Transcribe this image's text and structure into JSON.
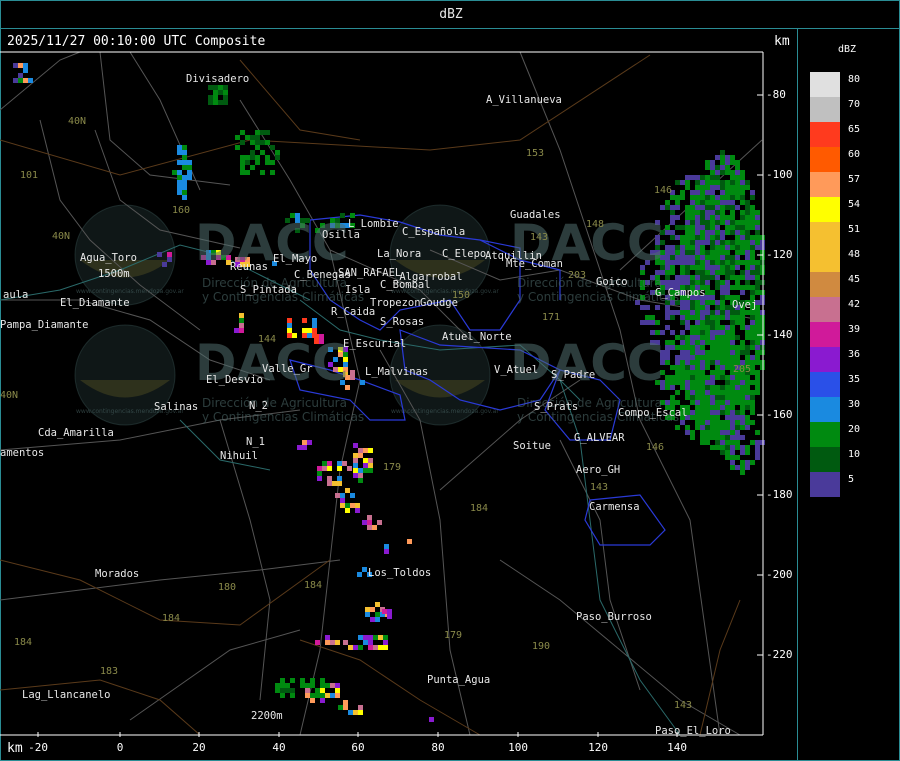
{
  "window_title": "dBZ",
  "timestamp": "2025/11/27 00:10:00 UTC Composite",
  "km_label": "km",
  "legend": {
    "title": "dBZ",
    "items": [
      {
        "value": "80",
        "color": "#e0e0e0"
      },
      {
        "value": "70",
        "color": "#c0c0c0"
      },
      {
        "value": "65",
        "color": "#ff3a1e"
      },
      {
        "value": "60",
        "color": "#ff5a00"
      },
      {
        "value": "57",
        "color": "#ff9a5a"
      },
      {
        "value": "54",
        "color": "#ffff00"
      },
      {
        "value": "51",
        "color": "#f5c030"
      },
      {
        "value": "48",
        "color": "#f5c030"
      },
      {
        "value": "45",
        "color": "#d08a40"
      },
      {
        "value": "42",
        "color": "#c87090"
      },
      {
        "value": "39",
        "color": "#d01a9a"
      },
      {
        "value": "36",
        "color": "#8a1ad0"
      },
      {
        "value": "35",
        "color": "#2a50e8"
      },
      {
        "value": "30",
        "color": "#1a8ae0"
      },
      {
        "value": "20",
        "color": "#008a10"
      },
      {
        "value": "10",
        "color": "#005a10"
      },
      {
        "value": "5",
        "color": "#4a3a9a"
      }
    ]
  },
  "axis_y_labels": [
    "-80",
    "-100",
    "-120",
    "-140",
    "-160",
    "-180",
    "-200",
    "-220"
  ],
  "axis_x_labels": [
    "-20",
    "0",
    "20",
    "40",
    "60",
    "80",
    "100",
    "120",
    "140"
  ],
  "places": {
    "divisadero": "Divisadero",
    "a_villanueva": "A_Villanueva",
    "guadales": "Guadales",
    "l_lombie": "L_Lombie",
    "c_espanola": "C_Española",
    "osilla": "Osilla",
    "la_nora": "La_Nora",
    "c_elepo": "C_Elepo",
    "atquillin": "Atquillin",
    "agua_toro": "Agua_Toro",
    "el_nihuil_mayo": "El_Mayo",
    "reunas": "Reunas",
    "c_benegas": "C_Benegas",
    "san_rafael": "SAN_RAFAEL",
    "algarrobal": "_Algarrobal",
    "mte_coman": "Mte_Coman",
    "goico": "Goico",
    "s_pintada": "S_Pintada",
    "c_bombal": "C_Bombal",
    "isla": "Isla",
    "tropezon": "Tropezon",
    "goudge": "Goudge",
    "g_campos": "G_Campos",
    "aula": "aula",
    "el_diamante": "El_Diamante",
    "pampa_diamante": "Pampa_Diamante",
    "r_caida": "R_Caida",
    "s_rosas": "S_Rosas",
    "ovejeria": "Ovej",
    "atuel_norte": "Atuel_Norte",
    "e_escurial": "E_Escurial",
    "v_atuel": "V_Atuel",
    "s_padre": "S_Padre",
    "valle_gr": "Valle_Gr",
    "l_malvinas": "L_Malvinas",
    "el_desvio": "El_Desvio",
    "s_prats": "S_Prats",
    "compo_escal": "Compo_Escal",
    "salinas": "Salinas",
    "n_2": "N_2",
    "cda_amarilla": "Cda_Amarilla",
    "g_alvear": "G_ALVEAR",
    "n_1": "N_1",
    "nihuil": "Nihuil",
    "soitue": "Soitue",
    "amentos": "amentos",
    "aero_gh": "Aero_GH",
    "carmensa": "Carmensa",
    "morados": "Morados",
    "los_toldos": "Los_Toldos",
    "paso_burroso": "Paso_Burroso",
    "punta_agua": "Punta_Agua",
    "lag_llancanelo": "Lag_Llancanelo",
    "paso_el_loro": "Paso_El_Loro",
    "rio_1500": "1500m",
    "alt_2200": "2200m",
    "villa_atuel": "V_Atuel"
  },
  "routes": {
    "r101": "101",
    "r40n_a": "40N",
    "r40n_b": "40N",
    "r40n_c": "40N",
    "r153": "153",
    "r146": "146",
    "r143a": "143",
    "r203": "203",
    "r171": "171",
    "r144": "144",
    "r150": "150",
    "r179a": "179",
    "r184a": "184",
    "r184b": "184",
    "r180": "180",
    "r184c": "184",
    "r184d": "184",
    "r183": "183",
    "r179b": "179",
    "r190": "190",
    "r143b": "143",
    "r143c": "143",
    "r205": "205",
    "r160": "160",
    "r146b": "146",
    "r148": "148"
  },
  "watermark": {
    "brand": "DACC",
    "line1": "Dirección de Agricultura",
    "line2": "y Contingencias Climáticas",
    "url": "www.contingencias.mendoza.gov.ar"
  }
}
